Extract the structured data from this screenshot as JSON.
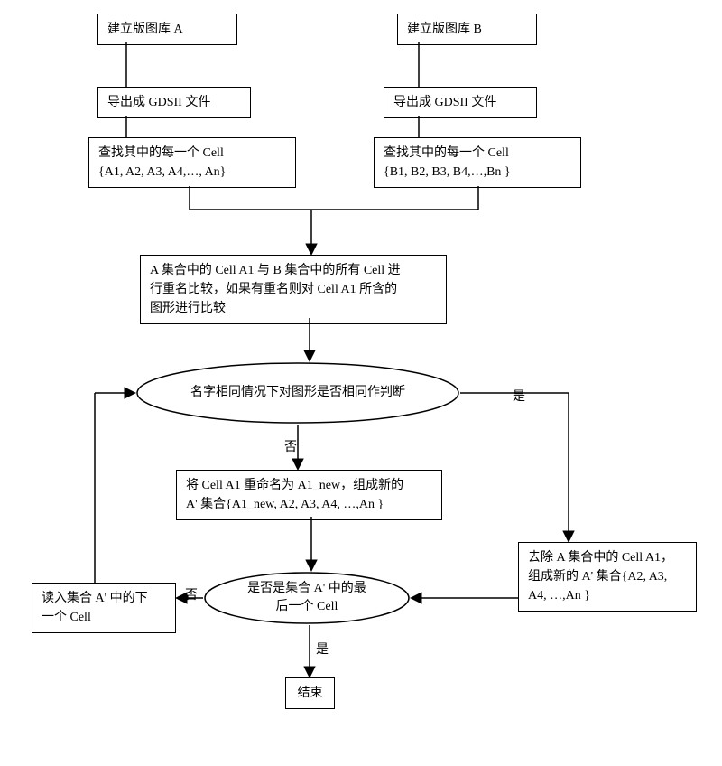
{
  "boxA1": "建立版图库 A",
  "boxA2": "导出成 GDSII 文件",
  "boxA3_l1": "查找其中的每一个 Cell",
  "boxA3_l2": "{A1, A2, A3, A4,…, An}",
  "boxB1": "建立版图库 B",
  "boxB2": "导出成 GDSII 文件",
  "boxB3_l1": "查找其中的每一个 Cell",
  "boxB3_l2": "{B1, B2, B3, B4,…,Bn }",
  "boxCmp_l1": "A 集合中的 Cell A1 与 B 集合中的所有 Cell 进",
  "boxCmp_l2": "行重名比较，如果有重名则对 Cell A1 所含的",
  "boxCmp_l3": "图形进行比较",
  "dec1": "名字相同情况下对图形是否相同作判断",
  "rename_l1": "将 Cell A1 重命名为 A1_new，组成新的",
  "rename_l2": "A' 集合{A1_new, A2, A3, A4, …,An }",
  "dec2_l1": "是否是集合 A' 中的最",
  "dec2_l2": "后一个 Cell",
  "readNext_l1": "读入集合 A' 中的下",
  "readNext_l2": "一个 Cell",
  "remove_l1": "去除 A 集合中的 Cell A1，",
  "remove_l2": "组成新的 A' 集合{A2, A3,",
  "remove_l3": "A4, …,An }",
  "end": "结束",
  "yes": "是",
  "no": "否"
}
